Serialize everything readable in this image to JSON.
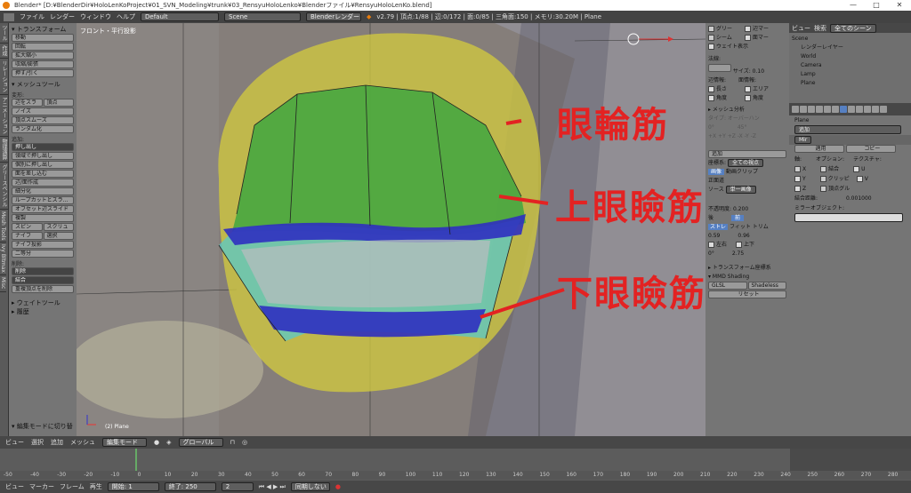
{
  "window": {
    "title": "Blender* [D:¥BlenderDir¥HoloLenKoProject¥01_SVN_Modeling¥trunk¥03_RensyuHoloLenko¥Blenderファイル¥RensyuHoloLenKo.blend]",
    "min": "—",
    "max": "□",
    "close": "✕"
  },
  "infobar": {
    "menus": [
      "ファイル",
      "レンダー",
      "ウィンドウ",
      "ヘルプ"
    ],
    "layout": "Default",
    "scene": "Scene",
    "engine": "Blenderレンダー",
    "stats": "v2.79 | 頂点:1/88 | 辺:0/172 | 面:0/85 | 三角面:150 | メモリ:30.20M | Plane"
  },
  "toolshelf": {
    "tabs": [
      "ツール",
      "作成",
      "リレーション",
      "アニメーション",
      "物理演算",
      "グリースペンシル",
      "Mesh Tools",
      "Ivy Bltmax",
      "Misc"
    ],
    "transform": {
      "header": "▾ トランスフォーム",
      "buttons": [
        "移動",
        "回転",
        "拡大縮小",
        "収縮/膨張",
        "押す/引く"
      ]
    },
    "mesh": {
      "header": "▾ メッシュツール",
      "deform_label": "変形:",
      "deform_rows": [
        [
          "辺をスラ",
          "頂点"
        ],
        [
          "ノイズ"
        ],
        [
          "頂点スムーズ"
        ],
        [
          "ランダム化"
        ]
      ],
      "add_label": "追加:",
      "extrude": "押し出し",
      "add_buttons": [
        "領域で押し出し",
        "個別に押し出し",
        "面を差し込む",
        "辺/面作成",
        "細分化",
        "ループカットとスラ…",
        "オフセット辺スライド",
        "複製"
      ],
      "add_rows": [
        [
          "スピン",
          "スクリュ"
        ],
        [
          "ナイフ",
          "選択"
        ]
      ],
      "add_tail": [
        "ナイフ投影",
        "二等分"
      ],
      "remove_label": "削除:",
      "remove_buttons": [
        "削除",
        "結合"
      ],
      "remove_tail": "重複頂点を削除"
    },
    "weight": "▸ ウェイトツール",
    "history": "▸ 履歴",
    "op": "▾ 編集モードに切り替"
  },
  "viewport": {
    "view_label": "フロント・平行投影",
    "object_label": "(2) Plane",
    "notes": [
      {
        "text": "眼輪筋"
      },
      {
        "text": "上眼瞼筋"
      },
      {
        "text": "下眼瞼筋"
      }
    ]
  },
  "npanel": {
    "overlay": [
      [
        "グリー",
        "辺マー"
      ],
      [
        "シーム",
        "面マー"
      ],
      [
        "ウェイト表示",
        ""
      ]
    ],
    "normals_label": "法線:",
    "normal_size": "サイズ: 0.10",
    "edge_label": "辺情報:",
    "face_label": "面情報:",
    "info": [
      [
        "長さ",
        "エリア"
      ],
      [
        "角度",
        "角度"
      ]
    ],
    "mesh_analysis": "▸ メッシュ分析",
    "type": "タイプ: オーバーハン",
    "type_vals": [
      "0°",
      "45°"
    ],
    "axes": [
      "+X",
      "+Y",
      "+Z",
      "-X",
      "-Y",
      "-Z"
    ],
    "add_button": "追加",
    "coord_label": "座標系:",
    "coord_value": "全ての視点",
    "tabs": [
      "画像",
      "動画クリップ"
    ],
    "align": "正面道",
    "source_label": "ソース",
    "source_value": "単一画像",
    "opacity_label": "不透明度:",
    "opacity": "0.200",
    "front_back": [
      "後",
      "前"
    ],
    "fit": [
      "ストレ",
      "フィット",
      "トリム"
    ],
    "vals": [
      "0.59",
      "0.96"
    ],
    "flips": [
      "左右",
      "上下"
    ],
    "rot": [
      "0°",
      "2.75"
    ],
    "transform_orient": "▸ トランスフォーム座標系",
    "mmd": "▾ MMD Shading",
    "glsl": "GLSL",
    "shadeless": "Shadeless",
    "reset": "リセット"
  },
  "outliner": {
    "header": {
      "view": "ビュー",
      "search": "検索",
      "filter": "全てのシーン"
    },
    "items": [
      "Scene",
      "レンダーレイヤー",
      "World",
      "Camera",
      "Lamp",
      "Plane"
    ]
  },
  "properties": {
    "breadcrumb": "Plane",
    "add_modifier": "追加",
    "modifier_name": "Mir",
    "apply": "適用",
    "copy": "コピー",
    "axis_label": "軸:",
    "options_label": "オプション:",
    "texture_label": "テクスチャ:",
    "axes": [
      "X",
      "Y",
      "Z"
    ],
    "options": [
      "結合",
      "クリッピ",
      "頂点グル"
    ],
    "tex": [
      "U",
      "V"
    ],
    "merge_dist_label": "結合距離:",
    "merge_dist": "0.001000",
    "mirror_obj_label": "ミラーオブジェクト:"
  },
  "viewport_header": {
    "items": [
      "ビュー",
      "選択",
      "追加",
      "メッシュ"
    ],
    "mode": "編集モード",
    "pivot": "グローバル"
  },
  "timeline": {
    "ticks": [
      "-50",
      "-40",
      "-30",
      "-20",
      "-10",
      "0",
      "10",
      "20",
      "30",
      "40",
      "50",
      "60",
      "70",
      "80",
      "90",
      "100",
      "110",
      "120",
      "130",
      "140",
      "150",
      "160",
      "170",
      "180",
      "190",
      "200",
      "210",
      "220",
      "230",
      "240",
      "250",
      "260",
      "270",
      "280"
    ],
    "current_frame": 2
  },
  "time_header": {
    "items": [
      "ビュー",
      "マーカー",
      "フレーム",
      "再生"
    ],
    "start_label": "開始:",
    "start": "1",
    "end_label": "終了:",
    "end": "250",
    "frame": "2",
    "sync": "同期しない"
  }
}
